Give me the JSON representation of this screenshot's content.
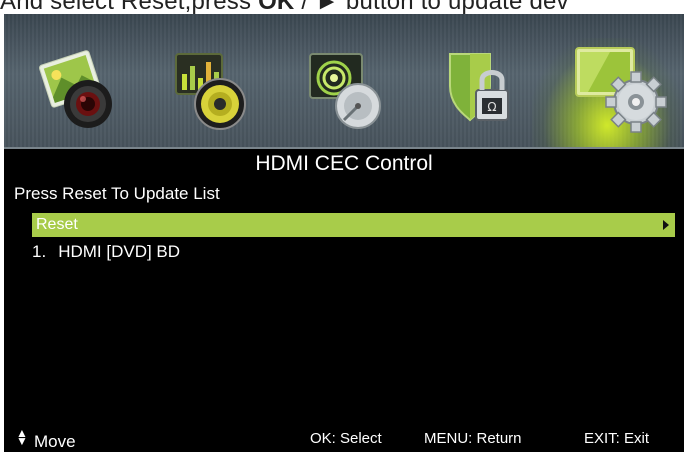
{
  "caption": {
    "prefix": "And select Reset,press ",
    "ok_key": "OK",
    "suffix": " / ► button to update dev"
  },
  "icons": [
    {
      "name": "picture-icon"
    },
    {
      "name": "sound-icon"
    },
    {
      "name": "channel-icon"
    },
    {
      "name": "lock-icon"
    },
    {
      "name": "setup-icon",
      "selected": true
    }
  ],
  "menu": {
    "title": "HDMI CEC Control",
    "subtitle": "Press Reset To Update List",
    "reset_label": "Reset",
    "devices": [
      {
        "number": "1.",
        "label": "HDMI [DVD] BD"
      }
    ]
  },
  "footer": {
    "move": "Move",
    "select": "OK: Select",
    "return": "MENU: Return",
    "exit": "EXIT: Exit"
  },
  "colors": {
    "highlight": "#a8cc4a",
    "background": "#000000"
  }
}
